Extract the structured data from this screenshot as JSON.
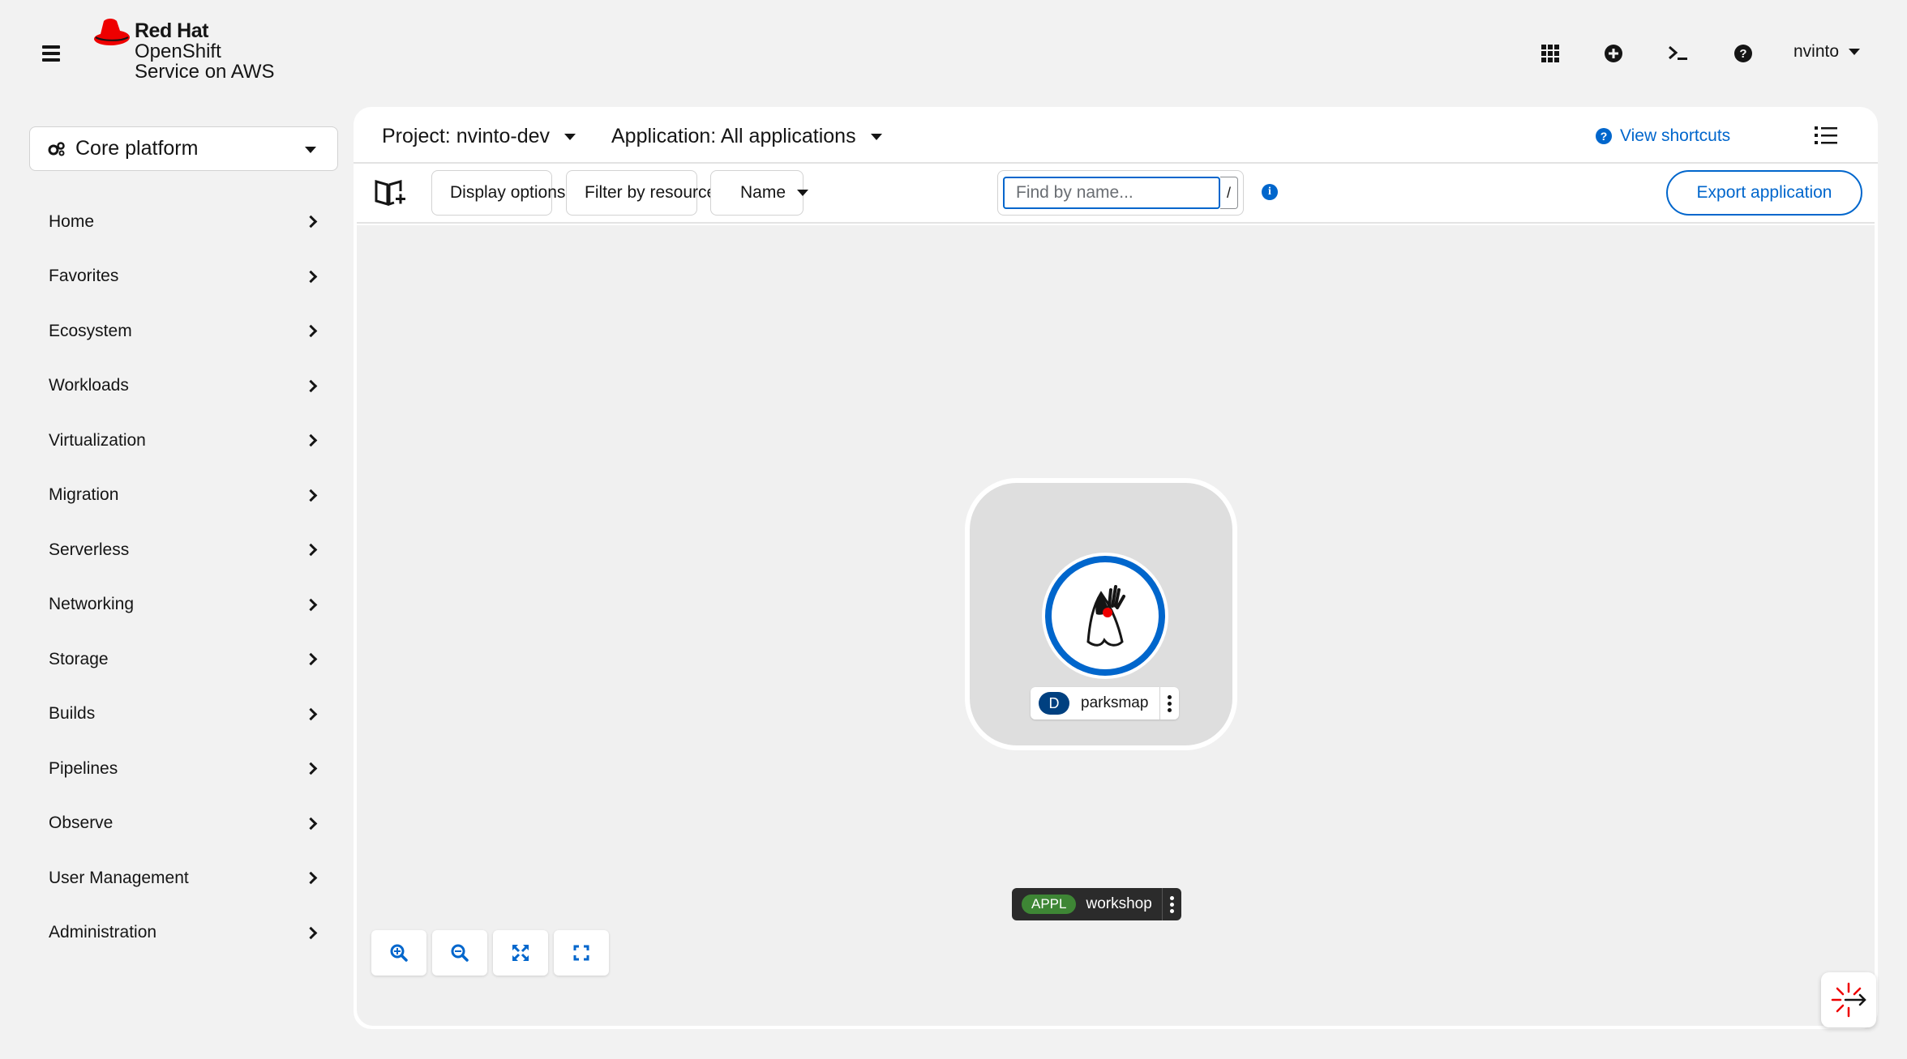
{
  "masthead": {
    "brand_line1": "Red Hat",
    "brand_line2": "OpenShift",
    "brand_line3": "Service on AWS",
    "user_name": "nvinto",
    "tool_icons": [
      "apps-grid-icon",
      "plus-circle-icon",
      "terminal-icon",
      "help-icon"
    ]
  },
  "sidebar": {
    "perspective": "Core platform",
    "items": [
      {
        "label": "Home"
      },
      {
        "label": "Favorites"
      },
      {
        "label": "Ecosystem"
      },
      {
        "label": "Workloads"
      },
      {
        "label": "Virtualization"
      },
      {
        "label": "Migration"
      },
      {
        "label": "Serverless"
      },
      {
        "label": "Networking"
      },
      {
        "label": "Storage"
      },
      {
        "label": "Builds"
      },
      {
        "label": "Pipelines"
      },
      {
        "label": "Observe"
      },
      {
        "label": "User Management"
      },
      {
        "label": "Administration"
      }
    ]
  },
  "context": {
    "project": "Project: nvinto-dev",
    "application": "Application: All applications",
    "view_shortcuts": "View shortcuts"
  },
  "toolbar": {
    "display_options": "Display options",
    "filter_by_resource": "Filter by resource",
    "filter_type": "Name",
    "search_placeholder": "Find by name...",
    "search_hotkey": "/",
    "export_button": "Export application"
  },
  "topology": {
    "workload": {
      "badge": "D",
      "name": "parksmap"
    },
    "application": {
      "badge": "APPL",
      "name": "workshop"
    }
  },
  "colors": {
    "accent": "#0066cc",
    "brand_red": "#ee0000",
    "appl_badge": "#3e8635",
    "deployment_badge": "#004080"
  }
}
